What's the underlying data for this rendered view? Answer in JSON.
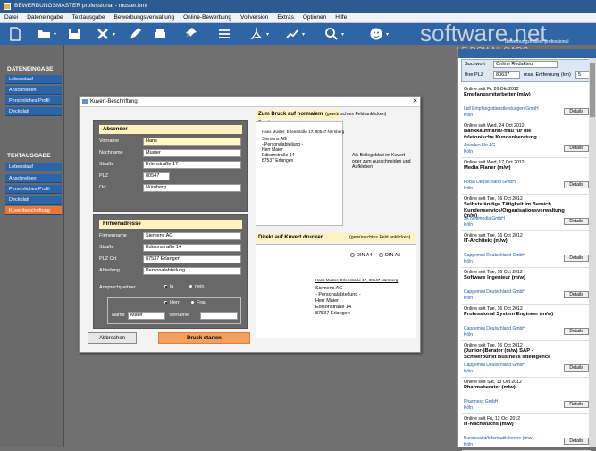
{
  "window": {
    "title": "BEWERBUNGSMASTER professional - muster.bmf"
  },
  "menu": [
    "Datei",
    "Dateneingabe",
    "Textausgabe",
    "Bewerbungsverwaltung",
    "Online-Bewerbung",
    "Vollversion",
    "Extras",
    "Optionen",
    "Hilfe"
  ],
  "watermark": {
    "main": "software.net",
    "sub": "AKTUELLE DOWNLOADS",
    "prog": "Bewerbungsmaster professional"
  },
  "sidebar": {
    "section1": "DATENEINGABE",
    "items1": [
      "Lebenslauf",
      "Anschreiben",
      "Persönliches Profil",
      "Deckblatt"
    ],
    "section2": "TEXTAUSGABE",
    "items2": [
      "Lebenslauf",
      "Anschreiben",
      "Persönliches Profil",
      "Deckblatt",
      "Kuvertbeschriftung"
    ]
  },
  "dialog": {
    "title": "Kuvert-Beschriftung",
    "absender": {
      "heading": "Absender",
      "labels": [
        "Vorname",
        "Nachname",
        "Straße",
        "PLZ",
        "Ort"
      ],
      "values": [
        "Hans",
        "Muster",
        "Erlenstraße 17",
        "80547",
        "Nürnberg"
      ]
    },
    "firma": {
      "heading": "Firmenadresse",
      "labels": [
        "Firmenname",
        "Straße",
        "PLZ Ort",
        "Abteilung"
      ],
      "values": [
        "Siemens AG",
        "Edisonstraße 14",
        "87537 Erlangen",
        "Personalabteilung"
      ],
      "ansprech_label": "Ansprechpartner",
      "ja": "ja",
      "nein": "nein",
      "herr": "Herr",
      "frau": "Frau",
      "name_label": "Name",
      "name_value": "Maier",
      "vorname_label": "Vorname",
      "vorname_value": ""
    },
    "normal": {
      "title": "Zum Druck auf normalem Papier",
      "note": "(gewünschtes Feld anklicken)",
      "return_line": "Hans Muster, Erlenstraße 17, 80547 Nürnberg",
      "addr": [
        "Siemens AG",
        "- Personalabteilung -",
        "Herr Maier",
        "Edisonstraße 14",
        "87537 Erlangen"
      ],
      "hint": "Als Beilegeblatt im Kuvert oder zum Ausschneiden und Aufkleben"
    },
    "direkt": {
      "title": "Direkt auf Kuvert drucken",
      "note": "(gewünschtes Feld anklicken)",
      "din_a4": "DIN A4",
      "din_a5": "DIN A5",
      "return_line": "Hans Muster, Erlenstraße 17, 80547 Nürnberg",
      "addr": [
        "Siemens AG",
        "- Personalabteilung -",
        "Herr Maier",
        "Edisonstraße 14",
        "87537 Erlangen"
      ]
    },
    "cancel": "Abbrechen",
    "print": "Druck starten"
  },
  "right": {
    "search_label": "Suchwort",
    "search_value": "Online Redakteur",
    "plz_label": "Ihre PLZ",
    "plz_value": "80637",
    "dist_label": "max. Entfernung (km)",
    "dist_value": "5",
    "details": "Details",
    "jobs": [
      {
        "date": "Online seit Fr, 26.Okt.2012",
        "title": "Empfangsmitarbeiter (m/w)",
        "company": "Lidl Empfangsdienstleistungen GmbH",
        "city": "Köln"
      },
      {
        "date": "Online seit Wed, 24 Oct 2012",
        "title": "Bankkaufmann/-frau für die telefonische Kundenberatung",
        "company": "Arvedeo Fin AG",
        "city": "Köln"
      },
      {
        "date": "Online seit Wed, 17 Oct 2012",
        "title": "Media Planer (m/w)",
        "company": "Forsa Deutschland GmbH",
        "city": "Köln"
      },
      {
        "date": "Online seit Tue, 16 Oct 2012",
        "title": "Selbstständige Tätigkeit im Bereich Kundenservice/Organisationsverwaltung (m/w)",
        "company": "JK Nettmedia GmbH",
        "city": "Köln"
      },
      {
        "date": "Online seit Tue, 16 Oct 2012",
        "title": "IT-Architekt (m/w)",
        "company": "Capgemini Deutschland GmbH",
        "city": "Köln"
      },
      {
        "date": "Online seit Tue, 16 Oct 2012",
        "title": "Software Ingenieur (m/w)",
        "company": "Capgemini Deutschland GmbH",
        "city": "Köln"
      },
      {
        "date": "Online seit Tue, 16 Oct 2012",
        "title": "Professional System Engineer (m/w)",
        "company": "Capgemini Deutschland GmbH",
        "city": "Köln"
      },
      {
        "date": "Online seit Tue, 16 Oct 2012",
        "title": "(Junior-)Berater (m/w) SAP - Schwerpunkt Business Intelligence",
        "company": "Capgemini Deutschland GmbH",
        "city": "Köln"
      },
      {
        "date": "Online seit Sat, 13 Oct 2012",
        "title": "Pharmaberater (m/w)",
        "company": "Pharmexx GmbH",
        "city": "Köln"
      },
      {
        "date": "Online seit Fri, 12 Oct 2012",
        "title": "IT-Nachwuchs (m/w)",
        "company": "Bundesamt/Informatik Innere (fmw)",
        "city": "Köln"
      }
    ]
  }
}
